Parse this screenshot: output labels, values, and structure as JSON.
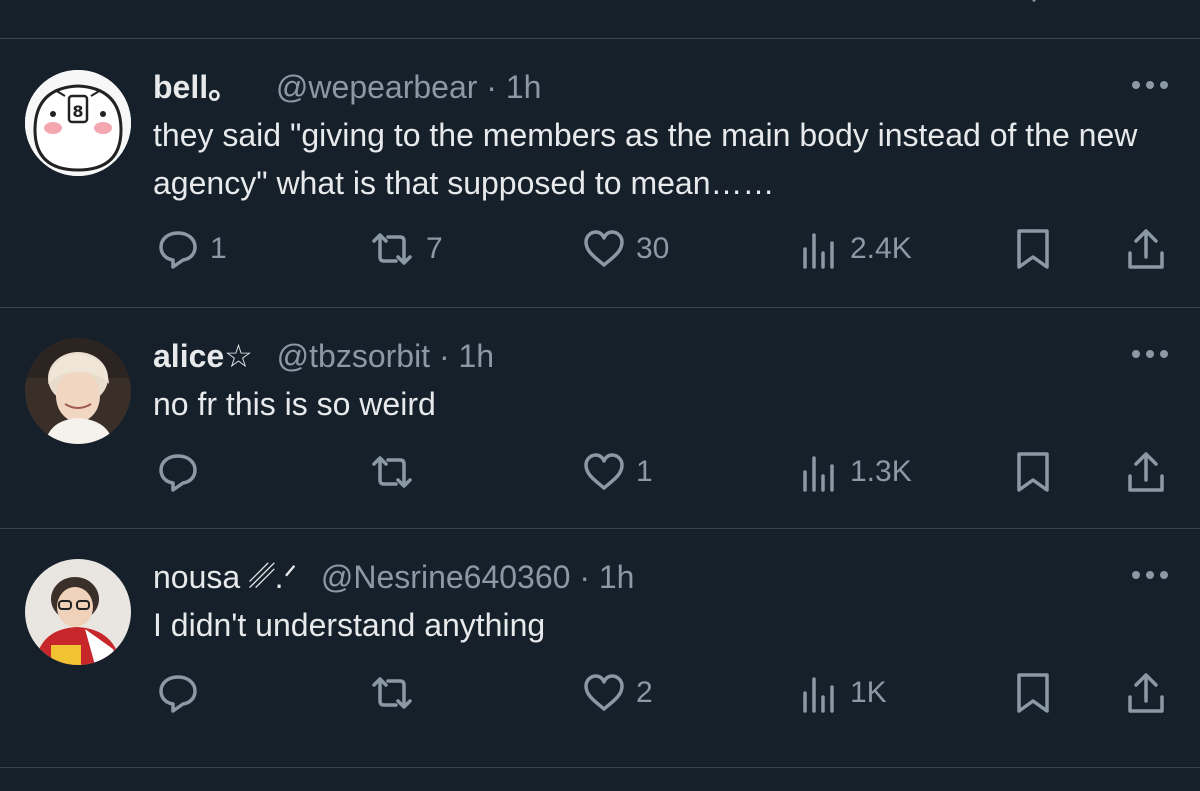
{
  "colors": {
    "background": "#15202b",
    "divider": "#38444d",
    "primary_text": "#e7e9ea",
    "secondary_text": "#8b98a5"
  },
  "tweets": [
    {
      "display_name": "bell。",
      "handle": "@wepearbear",
      "separator": "·",
      "time": "1h",
      "text": "they said \"giving to the members as the main body instead of the new agency\" what is that supposed to mean……",
      "replies": "1",
      "retweets": "7",
      "likes": "30",
      "views": "2.4K",
      "avatar": "cartoon-bear-avatar"
    },
    {
      "display_name": "alice☆",
      "handle": "@tbzsorbit",
      "separator": "·",
      "time": "1h",
      "text": "no fr this is so weird",
      "replies": "",
      "retweets": "",
      "likes": "1",
      "views": "1.3K",
      "avatar": "person-photo-avatar"
    },
    {
      "display_name": "nousa ␥.ᐟ",
      "handle": "@Nesrine640360",
      "separator": "·",
      "time": "1h",
      "text": "I didn't understand anything",
      "replies": "",
      "retweets": "",
      "likes": "2",
      "views": "1K",
      "avatar": "person-photo-avatar"
    }
  ]
}
